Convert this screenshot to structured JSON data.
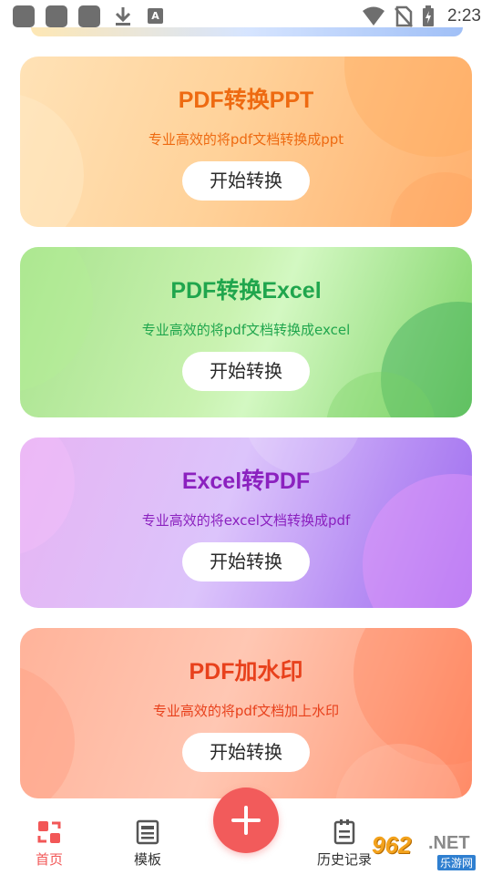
{
  "status_bar": {
    "time": "2:23",
    "icons": [
      "app-icon",
      "app-icon",
      "app-icon",
      "download-icon",
      "font-a-icon",
      "wifi-icon",
      "no-sim-icon",
      "battery-charging-icon"
    ],
    "font_icon_letter": "A"
  },
  "cards": [
    {
      "title": "PDF转换PPT",
      "subtitle": "专业高效的将pdf文档转换成ppt",
      "button": "开始转换",
      "color": "#ee6a11"
    },
    {
      "title": "PDF转换Excel",
      "subtitle": "专业高效的将pdf文档转换成excel",
      "button": "开始转换",
      "color": "#20a64d"
    },
    {
      "title": "Excel转PDF",
      "subtitle": "专业高效的将excel文档转换成pdf",
      "button": "开始转换",
      "color": "#8b21bf"
    },
    {
      "title": "PDF加水印",
      "subtitle": "专业高效的将pdf文档加上水印",
      "button": "开始转换",
      "color": "#e8411c"
    }
  ],
  "bottom_nav": {
    "items": [
      {
        "label": "首页",
        "icon": "home-convert-icon",
        "active": true
      },
      {
        "label": "模板",
        "icon": "template-icon",
        "active": false
      },
      {
        "label": "历史记录",
        "icon": "history-clipboard-icon",
        "active": false
      }
    ],
    "fab_icon": "plus-icon",
    "accent_color": "#f25757"
  },
  "watermark": {
    "brand": "962",
    "domain": ".NET",
    "cn": "乐游网"
  }
}
